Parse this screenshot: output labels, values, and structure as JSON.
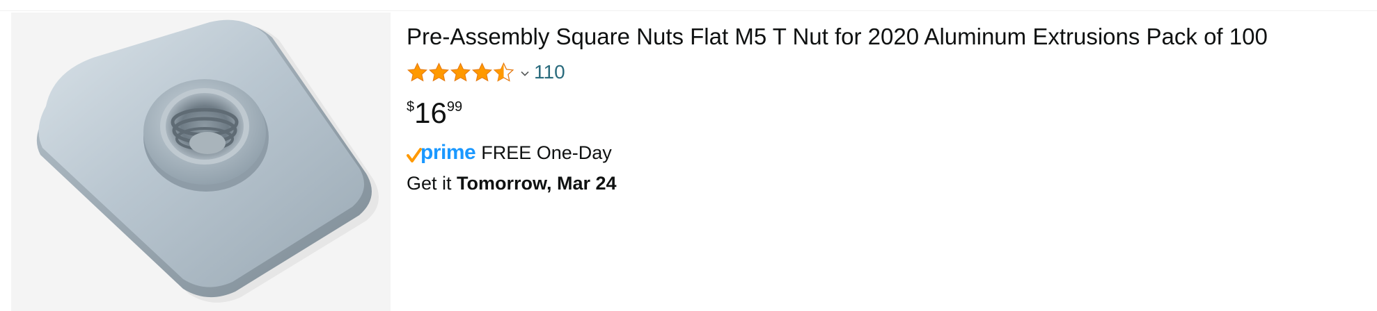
{
  "product": {
    "title": "Pre-Assembly Square Nuts Flat M5 T Nut for 2020 Aluminum Extrusions Pack of 100",
    "image_alt": "Zinc-plated M5 T nut",
    "rating": {
      "stars": 4.5,
      "max_stars": 5,
      "count": "110",
      "star_color": "#ff9900"
    },
    "price": {
      "symbol": "$",
      "whole": "16",
      "fraction": "99"
    },
    "prime": {
      "logo_text": "prime",
      "label": "FREE One-Day",
      "brand_color": "#1a98ff",
      "check_color": "#ff9900"
    },
    "delivery": {
      "prefix": "Get it ",
      "date": "Tomorrow, Mar 24"
    }
  }
}
